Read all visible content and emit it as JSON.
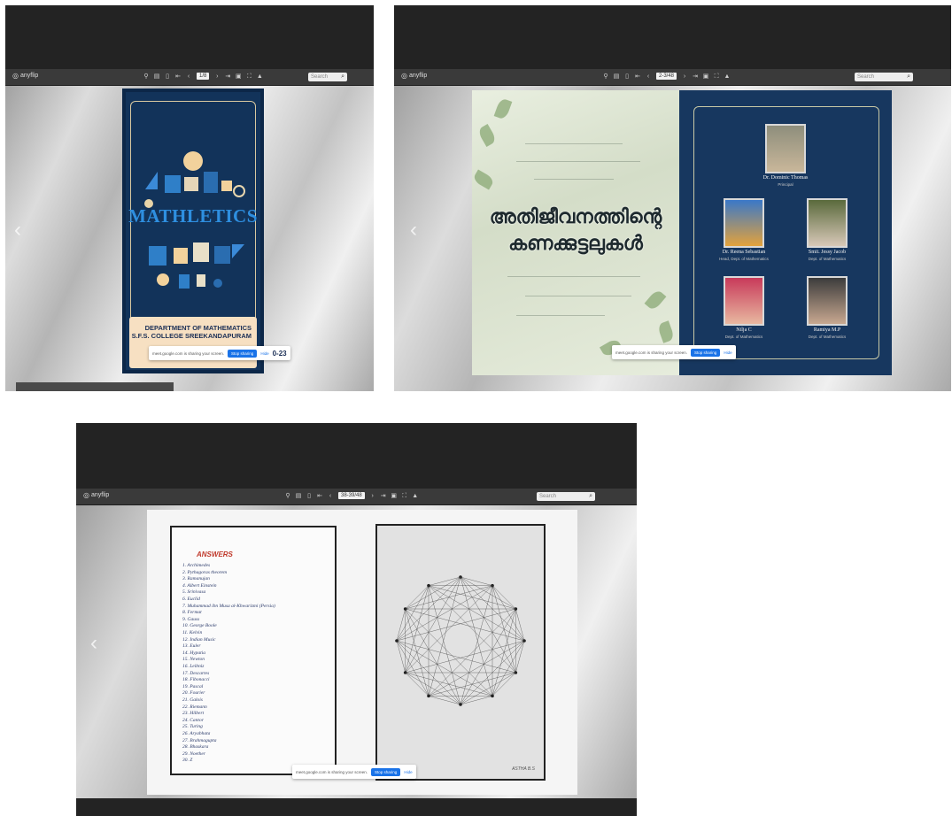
{
  "viewer": {
    "brand": "anyflip",
    "search_placeholder": "Search",
    "share_text": "meet.google.com is sharing your screen.",
    "stop_label": "Stop sharing",
    "hide_label": "Hide"
  },
  "shot1": {
    "page_indicator": "1/8",
    "cover_title": "MATHLETICS",
    "department": "DEPARTMENT OF MATHEMATICS",
    "college": "S.F.S. COLLEGE SREEKANDAPURAM",
    "year_fragment": "0-23"
  },
  "shot2": {
    "page_indicator": "2-3/48",
    "malayalam_title": "അതിജീവനത്തിന്റെ കണക്കുട്ടലുകൾ",
    "people": [
      {
        "name": "Dr. Dominic Thomas",
        "role": "Principal"
      },
      {
        "name": "Dr. Reena Sebastian",
        "role": "Head, Dept. of Mathematics"
      },
      {
        "name": "Smit. Jessy Jacob",
        "role": "Dept. of Mathematics"
      },
      {
        "name": "Nilja C",
        "role": "Dept. of Mathematics"
      },
      {
        "name": "Ramiya M.P",
        "role": "Dept. of Mathematics"
      }
    ]
  },
  "shot3": {
    "page_indicator": "38-39/48",
    "answers_heading": "ANSWERS",
    "answers": [
      "1. Archimedes",
      "2. Pythagoras theorem",
      "3. Ramanujan",
      "4. Albert Einstein",
      "5. Srinivasa",
      "6. Euclid",
      "7. Muhammad ibn Musa al-Khwarizmi (Persia)",
      "8. Fermat",
      "9. Gauss",
      "10. George Boole",
      "11. Kelvin",
      "12. Indian Music",
      "13. Euler",
      "14. Hypatia",
      "15. Newton",
      "16. Leibniz",
      "17. Descartes",
      "18. Fibonacci",
      "19. Pascal",
      "20. Fourier",
      "21. Galois",
      "22. Riemann",
      "23. Hilbert",
      "24. Cantor",
      "25. Turing",
      "26. Aryabhata",
      "27. Brahmagupta",
      "28. Bhaskara",
      "29. Noether",
      "30. Z"
    ],
    "signature": "ASTHA B.S"
  }
}
